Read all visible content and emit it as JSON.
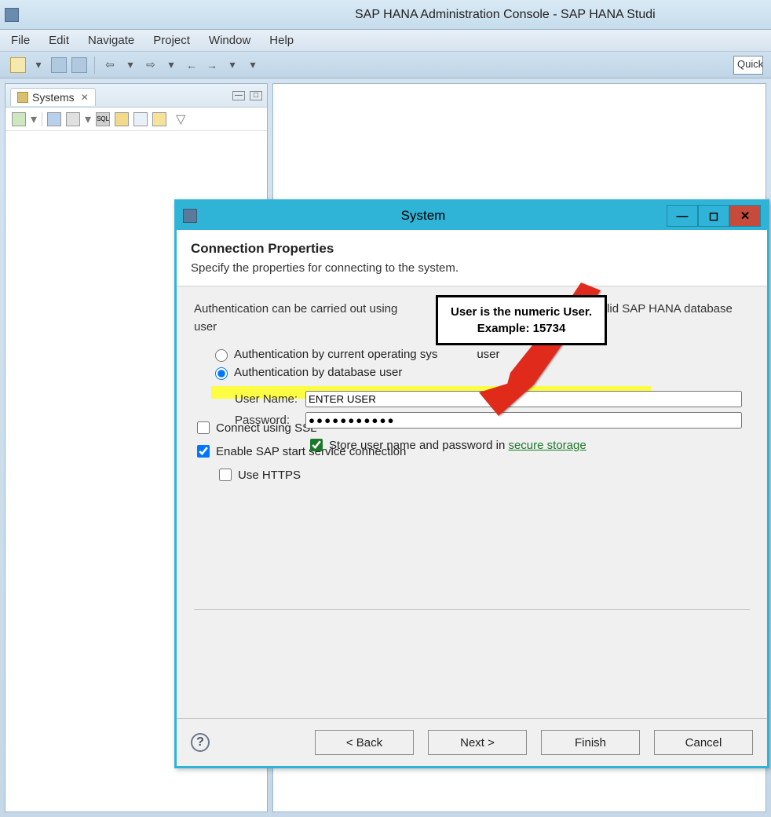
{
  "app": {
    "title": "SAP HANA Administration Console - SAP HANA Studi"
  },
  "menubar": {
    "items": [
      "File",
      "Edit",
      "Navigate",
      "Project",
      "Window",
      "Help"
    ]
  },
  "toolbar": {
    "quick_placeholder": "Quick"
  },
  "systems_panel": {
    "tab_label": "Systems",
    "tab_close_glyph": "✕"
  },
  "dialog": {
    "title": "System",
    "header_title": "Connection Properties",
    "header_subtitle": "Specify the properties for connecting to the system.",
    "auth_description_part1": "Authentication can be carried out using",
    "auth_description_part2": "alid SAP HANA database user",
    "radio_os_user": "Authentication by current operating sys",
    "radio_os_user_tail": "user",
    "radio_db_user": "Authentication by database user",
    "username_label": "User Name:",
    "username_value": "ENTER USER",
    "password_label": "Password:",
    "password_value": "●●●●●●●●●●●",
    "store_credentials_label": "Store user name and password in ",
    "secure_storage_link": "secure storage",
    "connect_ssl_label": "Connect using SSL",
    "enable_sap_start_label": "Enable SAP start service connection",
    "use_https_label": "Use HTTPS",
    "buttons": {
      "back": "< Back",
      "next": "Next >",
      "finish": "Finish",
      "cancel": "Cancel"
    }
  },
  "callout": {
    "line1": "User is the numeric User.",
    "line2": "Example: 15734"
  }
}
